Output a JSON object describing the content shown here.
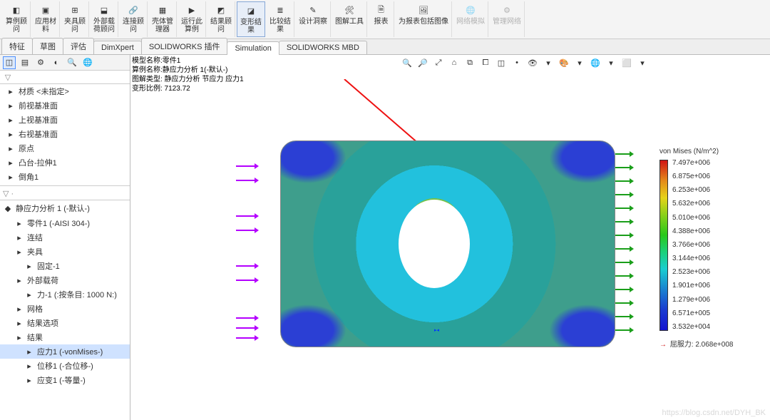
{
  "ribbon": {
    "items": [
      {
        "label": "算例顾\n问"
      },
      {
        "label": "应用材\n料"
      },
      {
        "label": "夹具顾\n问"
      },
      {
        "label": "外部载\n荷顾问"
      },
      {
        "label": "连接顾\n问"
      },
      {
        "label": "壳体管\n理器"
      },
      {
        "label": "运行此\n算例"
      },
      {
        "label": "结果顾\n问"
      },
      {
        "label": "变形结\n果"
      },
      {
        "label": "比较结\n果"
      },
      {
        "label": "设计洞察"
      },
      {
        "label": "图解工具"
      },
      {
        "label": "报表"
      },
      {
        "label": "为报表包括图像"
      },
      {
        "label": "网络模拟"
      },
      {
        "label": "管理网络"
      }
    ],
    "highlight_index": 8,
    "disabled_from": 14
  },
  "tabs": {
    "items": [
      "特征",
      "草图",
      "评估",
      "DimXpert",
      "SOLIDWORKS 插件",
      "Simulation",
      "SOLIDWORKS MBD"
    ],
    "active_index": 5
  },
  "fmtabs_count": 6,
  "filter_placeholder": "▽",
  "tree_top": [
    {
      "label": "材质 <未指定>",
      "icon": "material-icon"
    },
    {
      "label": "前视基准面",
      "icon": "plane-icon"
    },
    {
      "label": "上视基准面",
      "icon": "plane-icon"
    },
    {
      "label": "右视基准面",
      "icon": "plane-icon"
    },
    {
      "label": "原点",
      "icon": "origin-icon"
    },
    {
      "label": "凸台-拉伸1",
      "icon": "extrude-icon"
    },
    {
      "label": "倒角1",
      "icon": "chamfer-icon"
    }
  ],
  "study_root": "静应力分析 1 (-默认-)",
  "tree_study": [
    {
      "label": "零件1 (-AISI 304-)",
      "lvl": 1,
      "icon": "part-icon"
    },
    {
      "label": "连结",
      "lvl": 1,
      "icon": "connections-icon"
    },
    {
      "label": "夹具",
      "lvl": 1,
      "icon": "fixtures-icon"
    },
    {
      "label": "固定-1",
      "lvl": 2,
      "icon": "fixture-icon"
    },
    {
      "label": "外部载荷",
      "lvl": 1,
      "icon": "loads-icon"
    },
    {
      "label": "力-1 (:按条目: 1000 N:)",
      "lvl": 2,
      "icon": "force-icon"
    },
    {
      "label": "网格",
      "lvl": 1,
      "icon": "mesh-icon"
    },
    {
      "label": "结果选项",
      "lvl": 1,
      "icon": "options-icon"
    },
    {
      "label": "结果",
      "lvl": 1,
      "icon": "results-folder-icon"
    },
    {
      "label": "应力1 (-vonMises-)",
      "lvl": 2,
      "icon": "stress-icon",
      "sel": true
    },
    {
      "label": "位移1 (-合位移-)",
      "lvl": 2,
      "icon": "disp-icon"
    },
    {
      "label": "应变1 (-等量-)",
      "lvl": 2,
      "icon": "strain-icon"
    }
  ],
  "info_lines": [
    "模型名称:零件1",
    "算例名称:静应力分析 1(-默认-)",
    "图解类型: 静应力分析 节应力 应力1",
    "变形比例: 7123.72"
  ],
  "legend": {
    "title": "von Mises (N/m^2)",
    "ticks": [
      "7.497e+006",
      "6.875e+006",
      "6.253e+006",
      "5.632e+006",
      "5.010e+006",
      "4.388e+006",
      "3.766e+006",
      "3.144e+006",
      "2.523e+006",
      "1.901e+006",
      "1.279e+006",
      "6.571e+005",
      "3.532e+004"
    ],
    "yield_label": "屈服力:",
    "yield_value": "2.068e+008"
  },
  "watermark": "https://blog.csdn.net/DYH_BK",
  "chart_data": {
    "type": "heatmap",
    "title": "von Mises (N/m^2)",
    "value_range_min": 35320.0,
    "value_range_max": 7497000.0,
    "yield_strength": 206800000.0,
    "deformation_scale": 7123.72,
    "colorbar_ticks": [
      7497000.0,
      6875000.0,
      6253000.0,
      5632000.0,
      5010000.0,
      4388000.0,
      3766000.0,
      3144000.0,
      2523000.0,
      1901000.0,
      1279000.0,
      657100.0,
      35320.0
    ],
    "note": "FEA von-Mises stress plot on rectangular plate with central elliptical hole; max stress at hole top/bottom, min at plate corners; magenta arrows = applied force (left edge), green arrows = fixture (right edge)."
  }
}
